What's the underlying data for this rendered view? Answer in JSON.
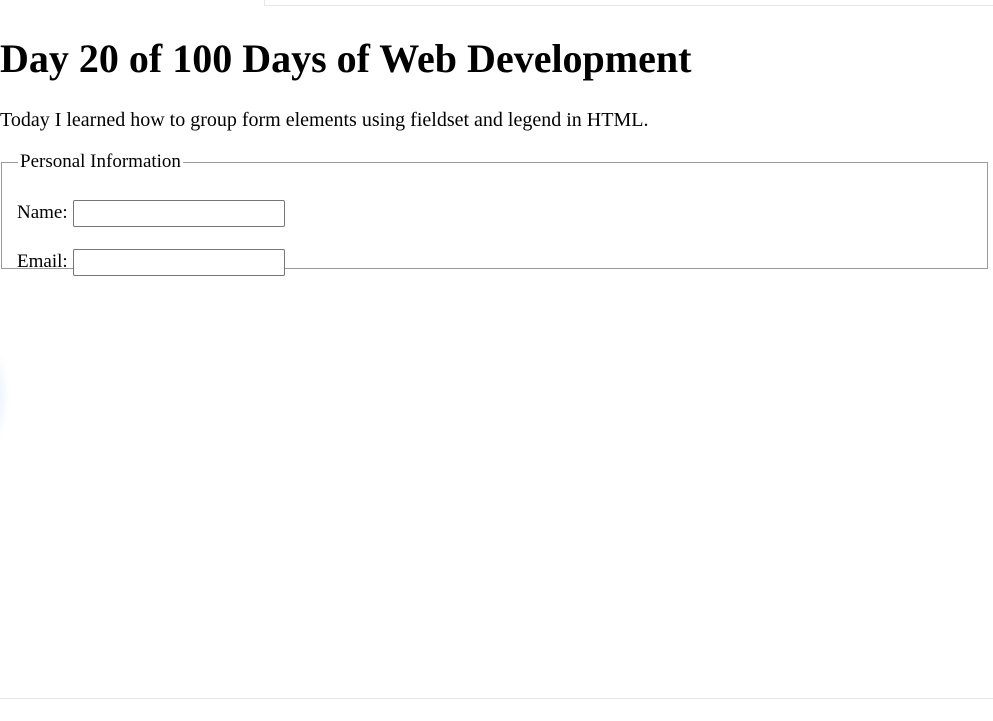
{
  "page": {
    "heading": "Day 20 of 100 Days of Web Development",
    "intro": "Today I learned how to group form elements using fieldset and legend in HTML."
  },
  "form": {
    "legend": "Personal Information",
    "fields": [
      {
        "label": "Name:",
        "value": ""
      },
      {
        "label": "Email:",
        "value": ""
      }
    ]
  }
}
